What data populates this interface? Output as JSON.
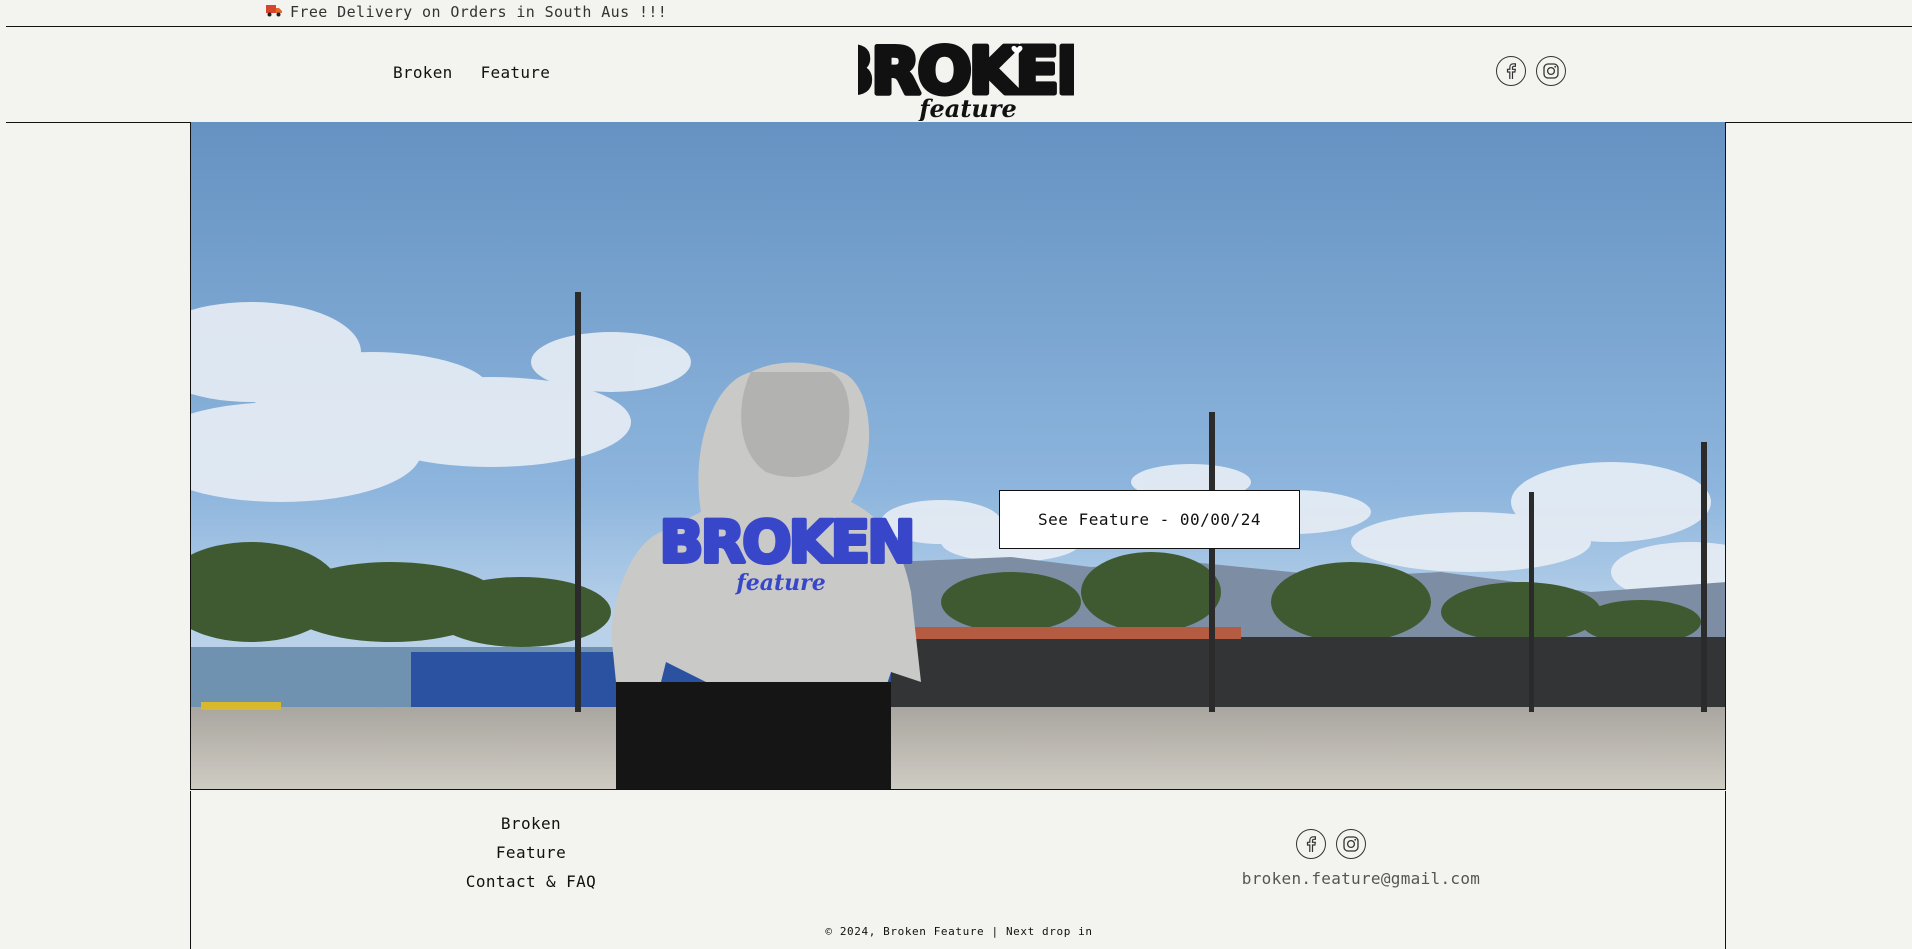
{
  "announcement": {
    "icon": "truck-icon",
    "text": "Free Delivery on Orders in South Aus !!!"
  },
  "header": {
    "nav": [
      {
        "label": "Broken"
      },
      {
        "label": "Feature"
      }
    ],
    "logo": {
      "line1": "BROKEN",
      "line2": "feature"
    },
    "social": [
      "facebook-icon",
      "instagram-icon"
    ]
  },
  "hero": {
    "cta_label": "See Feature - 00/00/24",
    "image": "photo of person in grey hoodie with blue Broken Feature print in a parking lot"
  },
  "footer": {
    "links": [
      {
        "label": "Broken"
      },
      {
        "label": "Feature"
      },
      {
        "label": "Contact & FAQ"
      }
    ],
    "social": [
      "facebook-icon",
      "instagram-icon"
    ],
    "email": "broken.feature@gmail.com",
    "copyright": "© 2024, Broken Feature | Next drop in"
  },
  "colors": {
    "background": "#f3f3ef",
    "text": "#111111",
    "sky": "#6f9ccc",
    "hoodie_print": "#3847c9"
  }
}
